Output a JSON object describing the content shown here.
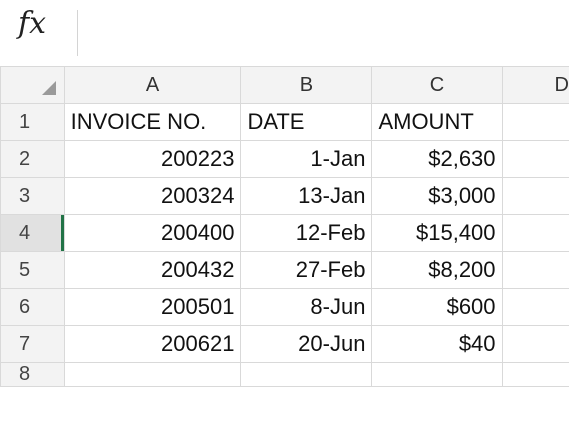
{
  "formula_bar": {
    "fx_label": "fx",
    "value": ""
  },
  "columns": [
    "A",
    "B",
    "C",
    "D"
  ],
  "rows": [
    {
      "num": "1",
      "cells": [
        "INVOICE NO.",
        "DATE",
        "AMOUNT",
        ""
      ]
    },
    {
      "num": "2",
      "cells": [
        "200223",
        "1-Jan",
        "$2,630",
        ""
      ]
    },
    {
      "num": "3",
      "cells": [
        "200324",
        "13-Jan",
        "$3,000",
        ""
      ]
    },
    {
      "num": "4",
      "cells": [
        "200400",
        "12-Feb",
        "$15,400",
        ""
      ]
    },
    {
      "num": "5",
      "cells": [
        "200432",
        "27-Feb",
        "$8,200",
        ""
      ]
    },
    {
      "num": "6",
      "cells": [
        "200501",
        "8-Jun",
        "$600",
        ""
      ]
    },
    {
      "num": "7",
      "cells": [
        "200621",
        "20-Jun",
        "$40",
        ""
      ]
    },
    {
      "num": "8",
      "cells": [
        "",
        "",
        "",
        ""
      ]
    }
  ],
  "active_row": "4",
  "colors": {
    "selection_accent": "#217346",
    "header_bg": "#f3f3f3",
    "gridline": "#d9d9d9"
  }
}
